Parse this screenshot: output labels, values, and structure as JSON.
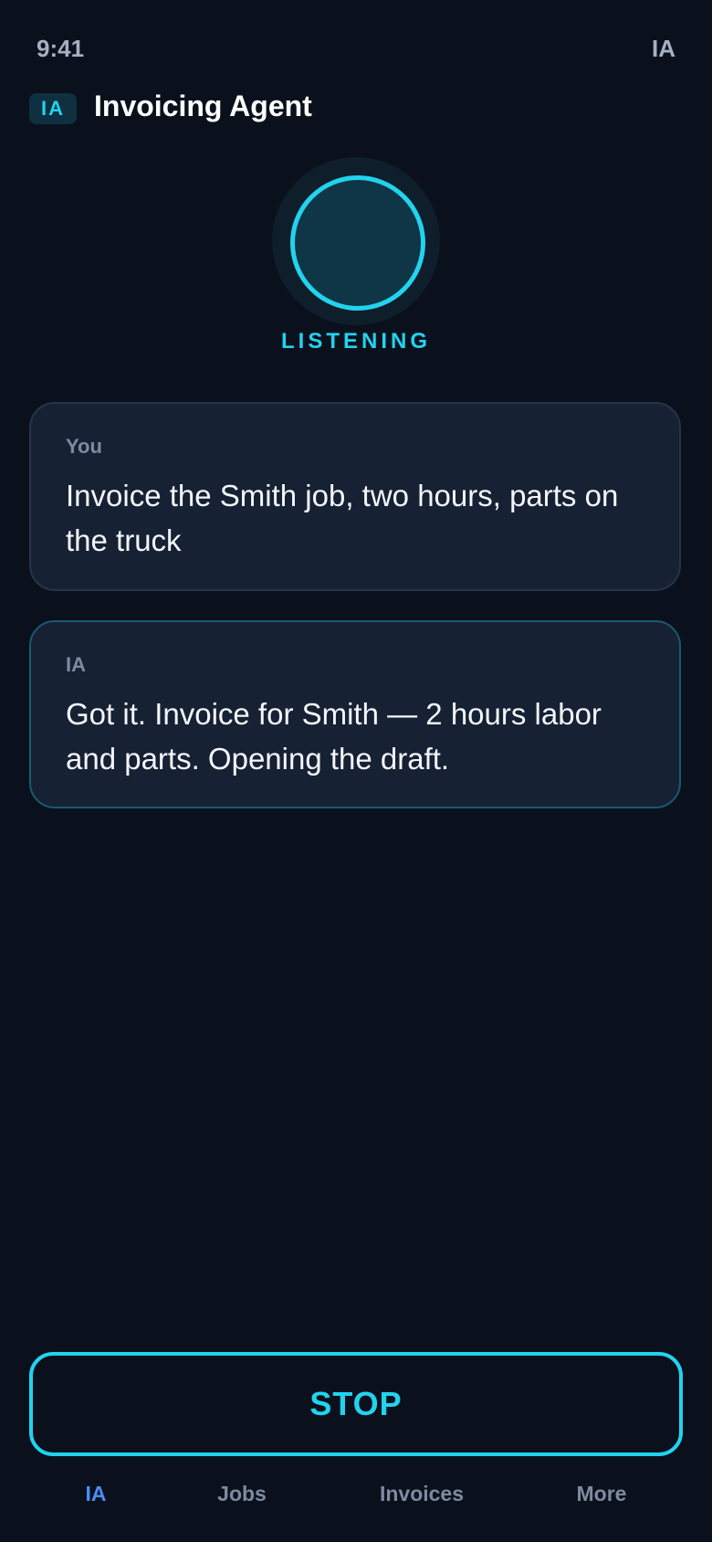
{
  "status_bar": {
    "time": "9:41",
    "right_label": "IA"
  },
  "header": {
    "badge": "IA",
    "title": "Invoicing Agent"
  },
  "voice": {
    "state_label": "LISTENING",
    "accent_color": "#22d3ee"
  },
  "conversation": [
    {
      "speaker": "You",
      "text": "Invoice the Smith job, two hours, parts on the truck"
    },
    {
      "speaker": "IA",
      "text": "Got it. Invoice for Smith — 2 hours labor and parts. Opening the draft."
    }
  ],
  "actions": {
    "stop_label": "STOP"
  },
  "nav": {
    "active": "IA",
    "items": [
      {
        "label": "IA"
      },
      {
        "label": "Jobs"
      },
      {
        "label": "Invoices"
      },
      {
        "label": "More"
      }
    ]
  }
}
